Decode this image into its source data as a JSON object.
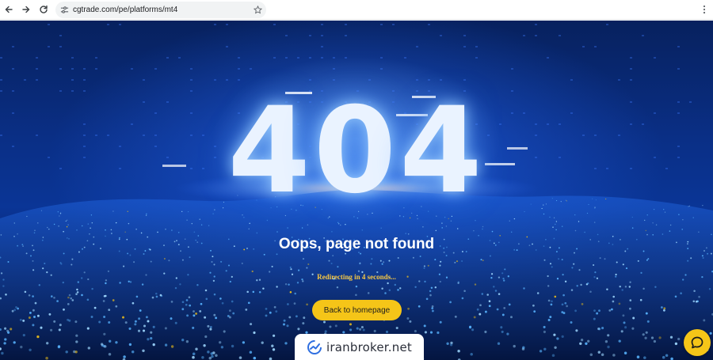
{
  "browser": {
    "url": "cgtrade.com/pe/platforms/mt4",
    "icons": [
      "back-arrow-icon",
      "forward-arrow-icon",
      "reload-icon",
      "site-settings-icon",
      "bookmark-star-icon",
      "more-menu-icon"
    ]
  },
  "page": {
    "error_digits": [
      "4",
      "0",
      "4"
    ],
    "headline": "Oops, page not found",
    "redirect_text": "Redirecting in 4 seconds...",
    "home_button_label": "Back to homepage",
    "watermark_text": "iranbroker.net",
    "chat_icon": "chat-bubble-icon"
  },
  "colors": {
    "accent": "#f5c518",
    "background_deep": "#061c59",
    "background_mid": "#0a3596",
    "headline": "#ffffff",
    "redirect": "#f6c744"
  }
}
